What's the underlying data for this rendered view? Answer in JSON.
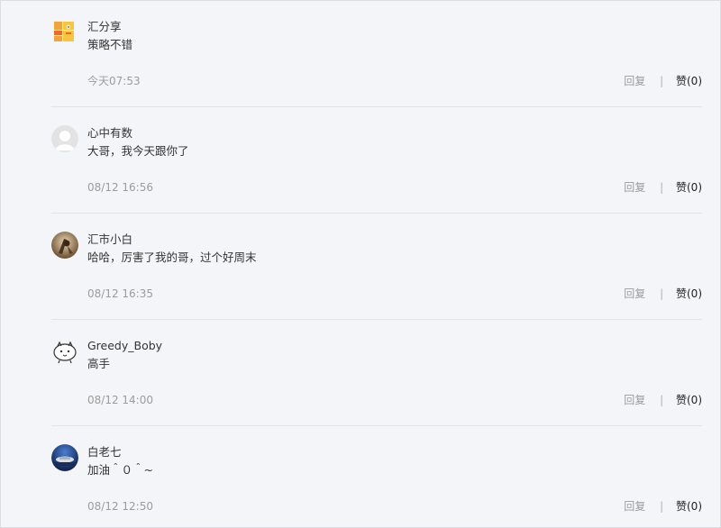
{
  "comments": [
    {
      "username": "汇分享",
      "content": "策略不错",
      "time": "今天07:53",
      "reply_label": "回复",
      "like_label": "赞(0)",
      "avatar_icon": "logo-icon"
    },
    {
      "username": "心中有数",
      "content": "大哥，我今天跟你了",
      "time": "08/12 16:56",
      "reply_label": "回复",
      "like_label": "赞(0)",
      "avatar_icon": "default-user-icon"
    },
    {
      "username": "汇市小白",
      "content": "哈哈，厉害了我的哥，过个好周末",
      "time": "08/12 16:35",
      "reply_label": "回复",
      "like_label": "赞(0)",
      "avatar_icon": "photo-avatar-icon"
    },
    {
      "username": "Greedy_Boby",
      "content": "高手",
      "time": "08/12 14:00",
      "reply_label": "回复",
      "like_label": "赞(0)",
      "avatar_icon": "cartoon-avatar-icon"
    },
    {
      "username": "白老七",
      "content": "加油＾０＾~",
      "time": "08/12 12:50",
      "reply_label": "回复",
      "like_label": "赞(0)",
      "avatar_icon": "photo-avatar-icon"
    }
  ],
  "separator": "|",
  "colors": {
    "background": "#f4f5f9",
    "text": "#333333",
    "muted": "#9c9c9c",
    "divider": "#e2e3e8"
  }
}
